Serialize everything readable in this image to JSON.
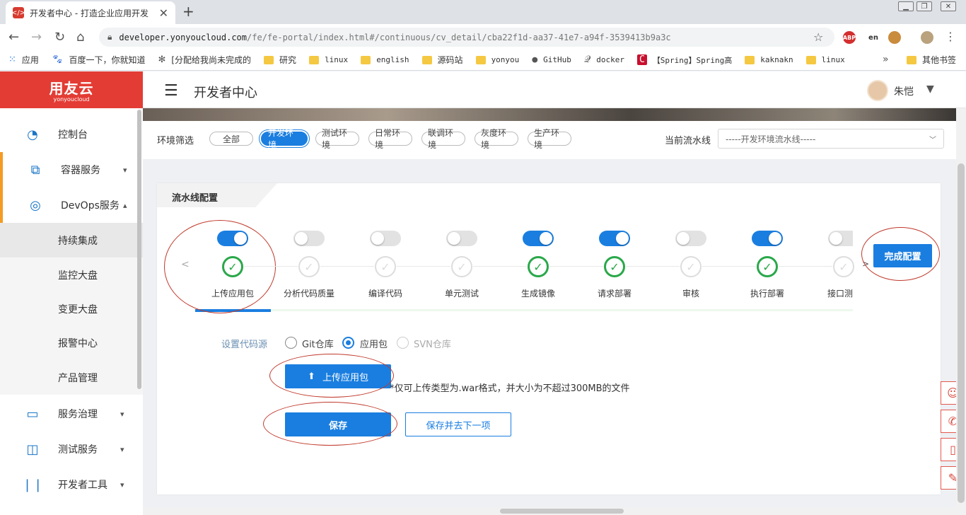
{
  "browser": {
    "tab_title": "开发者中心 - 打造企业应用开发",
    "favicon_text": "</>",
    "url_host": "developer.yonyoucloud.com",
    "url_path": "/fe/fe-portal/index.html#/continuous/cv_detail/cba22f1d-aa37-41e7-a94f-3539413b9a3c",
    "extensions": [
      "ABP",
      "en",
      "cookie"
    ],
    "bookmarks": [
      {
        "label": "应用",
        "icon": "apps-icon"
      },
      {
        "label": "百度一下，你就知道",
        "icon": "baidu-icon"
      },
      {
        "label": "[分配给我尚未完成的",
        "icon": "jira-icon"
      },
      {
        "label": "研究",
        "icon": "folder-icon"
      },
      {
        "label": "linux",
        "icon": "folder-icon"
      },
      {
        "label": "english",
        "icon": "folder-icon"
      },
      {
        "label": "源码站",
        "icon": "folder-icon"
      },
      {
        "label": "yonyou",
        "icon": "folder-icon"
      },
      {
        "label": "GitHub",
        "icon": "github-icon"
      },
      {
        "label": "docker",
        "icon": "docker-icon"
      },
      {
        "label": "【Spring】Spring高",
        "icon": "csdn-icon"
      },
      {
        "label": "kaknakn",
        "icon": "folder-icon"
      },
      {
        "label": "linux",
        "icon": "folder-icon"
      }
    ],
    "bookmarks_more": "»",
    "other_bookmarks": "其他书签"
  },
  "app": {
    "logo_cn": "用友云",
    "logo_en": "yonyoucloud",
    "header_title": "开发者中心",
    "user_name": "朱恺"
  },
  "sidebar": {
    "items": [
      {
        "label": "控制台",
        "icon": "dashboard-icon"
      },
      {
        "label": "容器服务",
        "icon": "container-icon",
        "chevron": "﹀"
      },
      {
        "label": "DevOps服务",
        "icon": "devops-icon",
        "chevron": "︿"
      },
      {
        "label": "服务治理",
        "icon": "laptop-icon",
        "chevron": "﹀"
      },
      {
        "label": "测试服务",
        "icon": "bag-icon",
        "chevron": "﹀"
      },
      {
        "label": "开发者工具",
        "icon": "tools-icon",
        "chevron": "﹀"
      }
    ],
    "subitems": [
      "持续集成",
      "监控大盘",
      "变更大盘",
      "报警中心",
      "产品管理"
    ]
  },
  "filter": {
    "label": "环境筛选",
    "envs": [
      "全部",
      "开发环境",
      "测试环境",
      "日常环境",
      "联调环境",
      "灰度环境",
      "生产环境"
    ],
    "selected": "开发环境",
    "pipeline_label": "当前流水线",
    "pipeline_value": "-----开发环境流水线-----"
  },
  "pipeline": {
    "title": "流水线配置",
    "finish_label": "完成配置",
    "steps": [
      {
        "label": "上传应用包",
        "enabled": true,
        "done": true
      },
      {
        "label": "分析代码质量",
        "enabled": false,
        "done": false
      },
      {
        "label": "编译代码",
        "enabled": false,
        "done": false
      },
      {
        "label": "单元测试",
        "enabled": false,
        "done": false
      },
      {
        "label": "生成镜像",
        "enabled": true,
        "done": true
      },
      {
        "label": "请求部署",
        "enabled": true,
        "done": true
      },
      {
        "label": "审核",
        "enabled": false,
        "done": false
      },
      {
        "label": "执行部署",
        "enabled": true,
        "done": true
      },
      {
        "label": "接口测",
        "enabled": false,
        "done": false
      }
    ]
  },
  "form": {
    "source_label": "设置代码源",
    "source_options": [
      {
        "label": "Git仓库",
        "state": "off"
      },
      {
        "label": "应用包",
        "state": "on"
      },
      {
        "label": "SVN仓库",
        "state": "disabled"
      }
    ],
    "upload_label": "上传应用包",
    "upload_hint": "*仅可上传类型为.war格式，并大小为不超过300MB的文件",
    "save_label": "保存",
    "save_next_label": "保存并去下一项"
  },
  "float_buttons": [
    "robot-icon",
    "phone-icon",
    "mobile-icon",
    "feedback-icon"
  ],
  "colors": {
    "primary": "#1a7ee0",
    "brand_red": "#e33c34",
    "success": "#2aa84a",
    "accent_orange": "#f59a23",
    "annotation": "#c0392b"
  }
}
